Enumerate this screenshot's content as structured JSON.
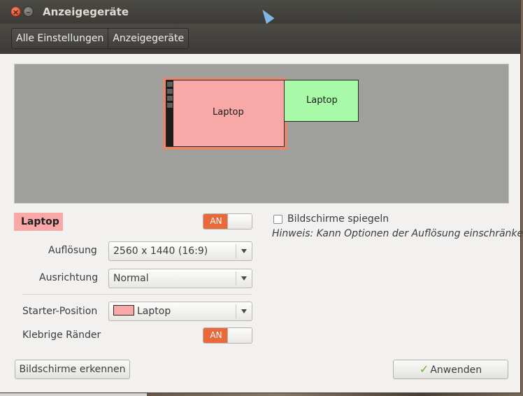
{
  "window": {
    "title": "Anzeigegeräte"
  },
  "breadcrumb": {
    "items": [
      "Alle Einstellungen",
      "Anzeigegeräte"
    ]
  },
  "preview": {
    "monitors": [
      {
        "label": "Laptop",
        "color": "#f9a8a8",
        "selected": true
      },
      {
        "label": "Laptop",
        "color": "#a8f9a8",
        "selected": false
      }
    ]
  },
  "display": {
    "name": "Laptop",
    "power_toggle": "AN",
    "resolution_label": "Auflösung",
    "resolution_value": "2560 x 1440 (16:9)",
    "rotation_label": "Ausrichtung",
    "rotation_value": "Normal",
    "launcher_label": "Starter-Position",
    "launcher_value": "Laptop",
    "sticky_label": "Klebrige Ränder",
    "sticky_toggle": "AN"
  },
  "mirror": {
    "label": "Bildschirme spiegeln",
    "checked": false,
    "hint": "Hinweis: Kann Optionen der Auflösung einschränken"
  },
  "buttons": {
    "detect": "Bildschirme erkennen",
    "apply": "Anwenden"
  },
  "colors": {
    "accent": "#e9693a",
    "monitor_primary": "#f9a8a8",
    "monitor_secondary": "#a8f9a8"
  }
}
